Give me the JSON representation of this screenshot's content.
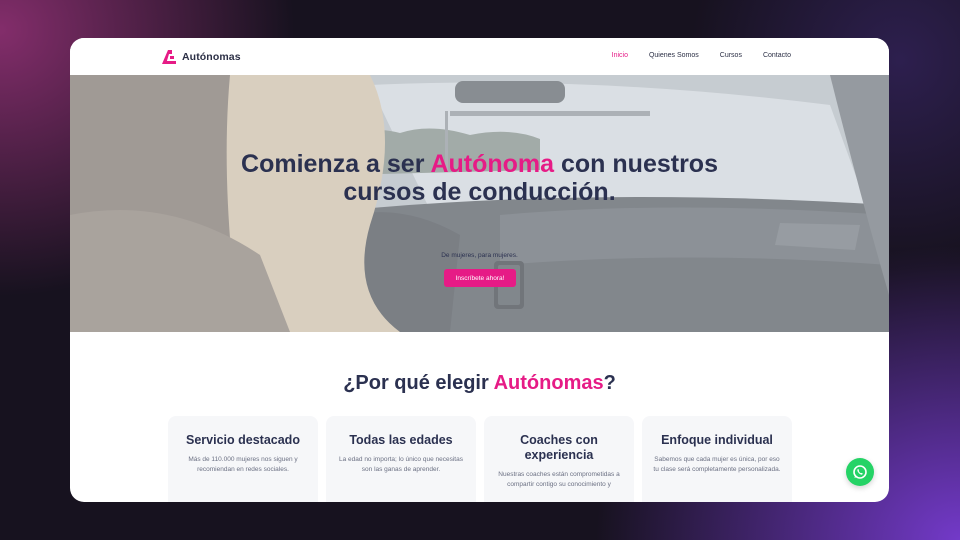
{
  "brand": {
    "name": "Autónomas",
    "accent": "#e61b86",
    "text_color": "#2b3150",
    "whatsapp_color": "#25d366"
  },
  "nav": {
    "items": [
      {
        "label": "Inicio",
        "active": true
      },
      {
        "label": "Quienes Somos",
        "active": false
      },
      {
        "label": "Cursos",
        "active": false
      },
      {
        "label": "Contacto",
        "active": false
      }
    ]
  },
  "hero": {
    "title_line1_pre": "Comienza a ser ",
    "title_highlight": "Autónoma",
    "title_line1_post": " con nuestros",
    "title_line2": "cursos de conducción.",
    "subtitle": "De mujeres, para mujeres.",
    "cta_label": "Inscríbete ahora!"
  },
  "why": {
    "title_pre": "¿Por qué elegir ",
    "title_highlight": "Autónomas",
    "title_post": "?",
    "cards": [
      {
        "title": "Servicio destacado",
        "text": "Más de 110.000 mujeres nos siguen y recomiendan en redes sociales."
      },
      {
        "title": "Todas las edades",
        "text": "La edad no importa; lo único que necesitas son las ganas de aprender."
      },
      {
        "title": "Coaches con experiencia",
        "text": "Nuestras coaches están comprometidas a compartir contigo su conocimiento y"
      },
      {
        "title": "Enfoque individual",
        "text": "Sabemos que cada mujer es única, por eso tu clase será completamente personalizada."
      }
    ]
  },
  "icons": {
    "logo": "autonomas-logo-icon",
    "whatsapp": "whatsapp-icon"
  }
}
